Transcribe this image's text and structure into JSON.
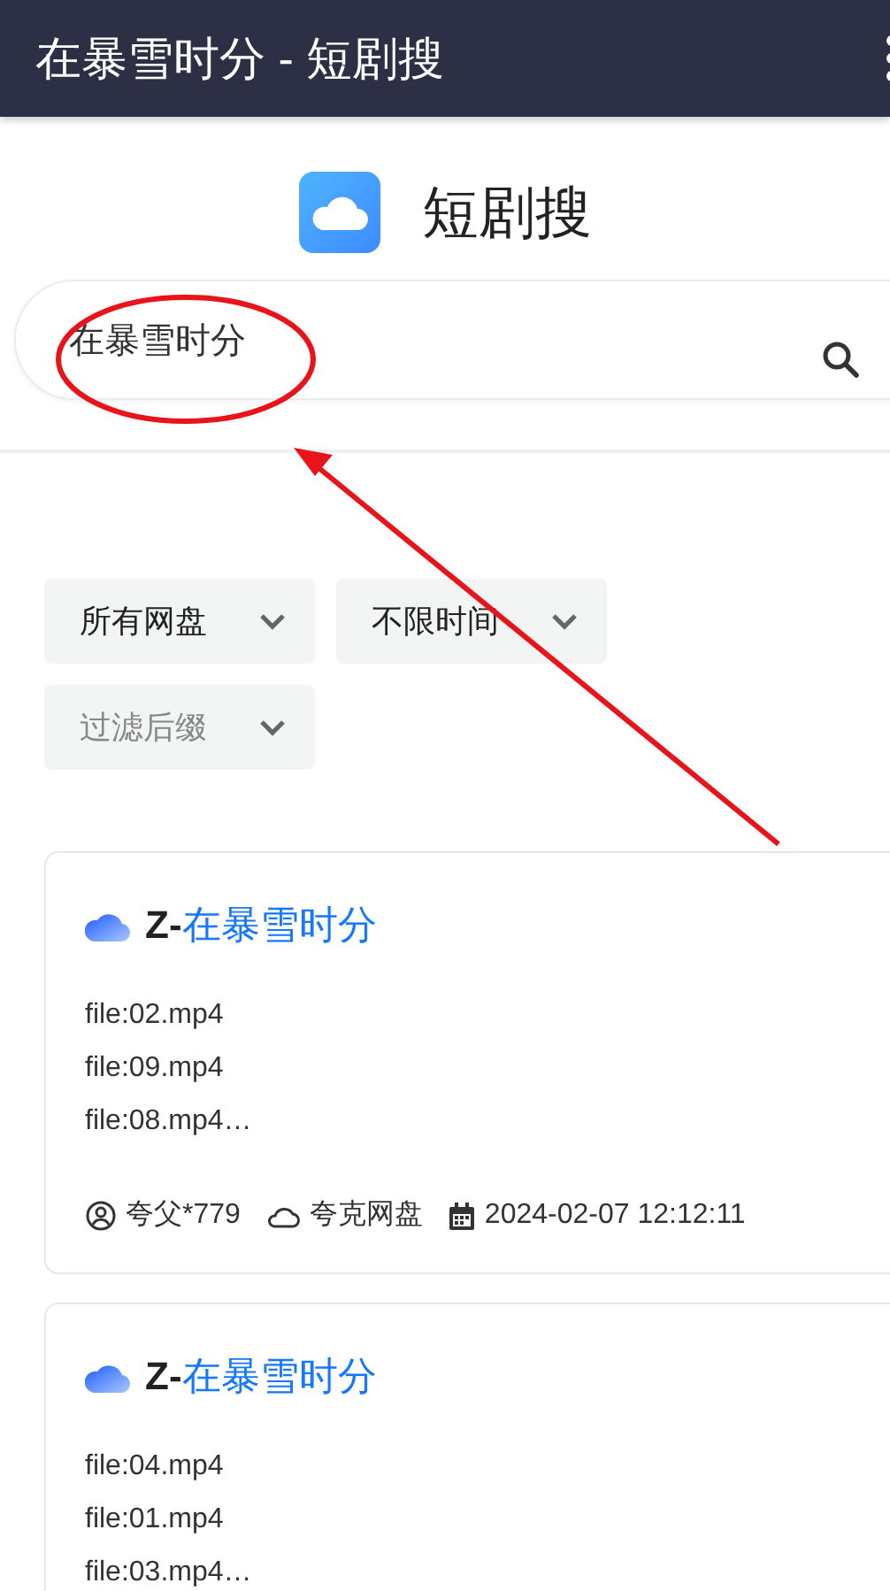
{
  "app_bar": {
    "title": "在暴雪时分 - 短剧搜"
  },
  "brand": {
    "name": "短剧搜"
  },
  "search": {
    "value": "在暴雪时分"
  },
  "filters": [
    {
      "value": "所有网盘"
    },
    {
      "value": "不限时间"
    },
    {
      "placeholder": "过滤后缀"
    }
  ],
  "results": [
    {
      "prefix": "Z-",
      "name": "在暴雪时分",
      "files": [
        "file:02.mp4",
        "file:09.mp4",
        "file:08.mp4…"
      ],
      "user": "夸父*779",
      "drive": "夸克网盘",
      "date": "2024-02-07 12:12:11"
    },
    {
      "prefix": "Z-",
      "name": "在暴雪时分",
      "files": [
        "file:04.mp4",
        "file:01.mp4",
        "file:03.mp4…"
      ]
    }
  ]
}
